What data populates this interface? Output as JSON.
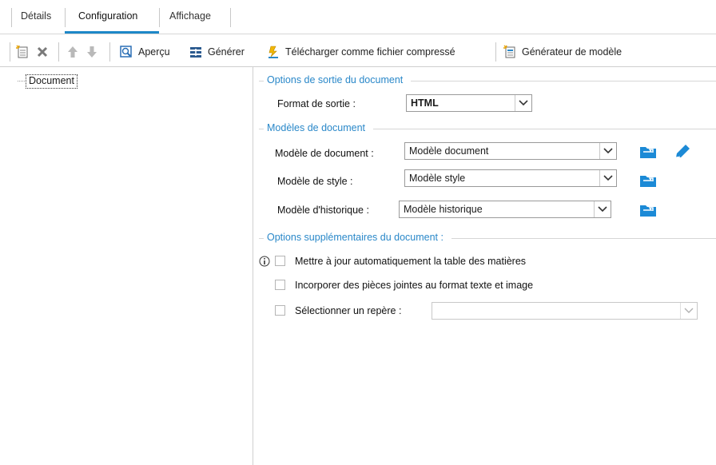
{
  "tabs": [
    {
      "label": "Détails"
    },
    {
      "label": "Configuration"
    },
    {
      "label": "Affichage"
    }
  ],
  "toolbar": {
    "preview_label": "Aperçu",
    "generate_label": "Générer",
    "download_label": "Télécharger comme fichier compressé",
    "template_generator_label": "Générateur de modèle"
  },
  "tree": {
    "document_label": "Document"
  },
  "output_options": {
    "title": "Options de sortie du document",
    "format_label": "Format de sortie :",
    "format_value": "HTML"
  },
  "templates": {
    "title": "Modèles de document",
    "document_label": "Modèle de document :",
    "document_value": "Modèle document",
    "style_label": "Modèle de style :",
    "style_value": "Modèle style",
    "history_label": "Modèle d'historique :",
    "history_value": "Modèle historique"
  },
  "extra_options": {
    "title": "Options supplémentaires du document :",
    "toc_label": "Mettre à jour automatiquement la table des matières",
    "attachments_label": "Incorporer des pièces jointes au format texte et image",
    "bookmark_label": "Sélectionner un repère :",
    "bookmark_value": ""
  },
  "colors": {
    "accent": "#1e88c8",
    "group_title": "#2a88c9"
  }
}
